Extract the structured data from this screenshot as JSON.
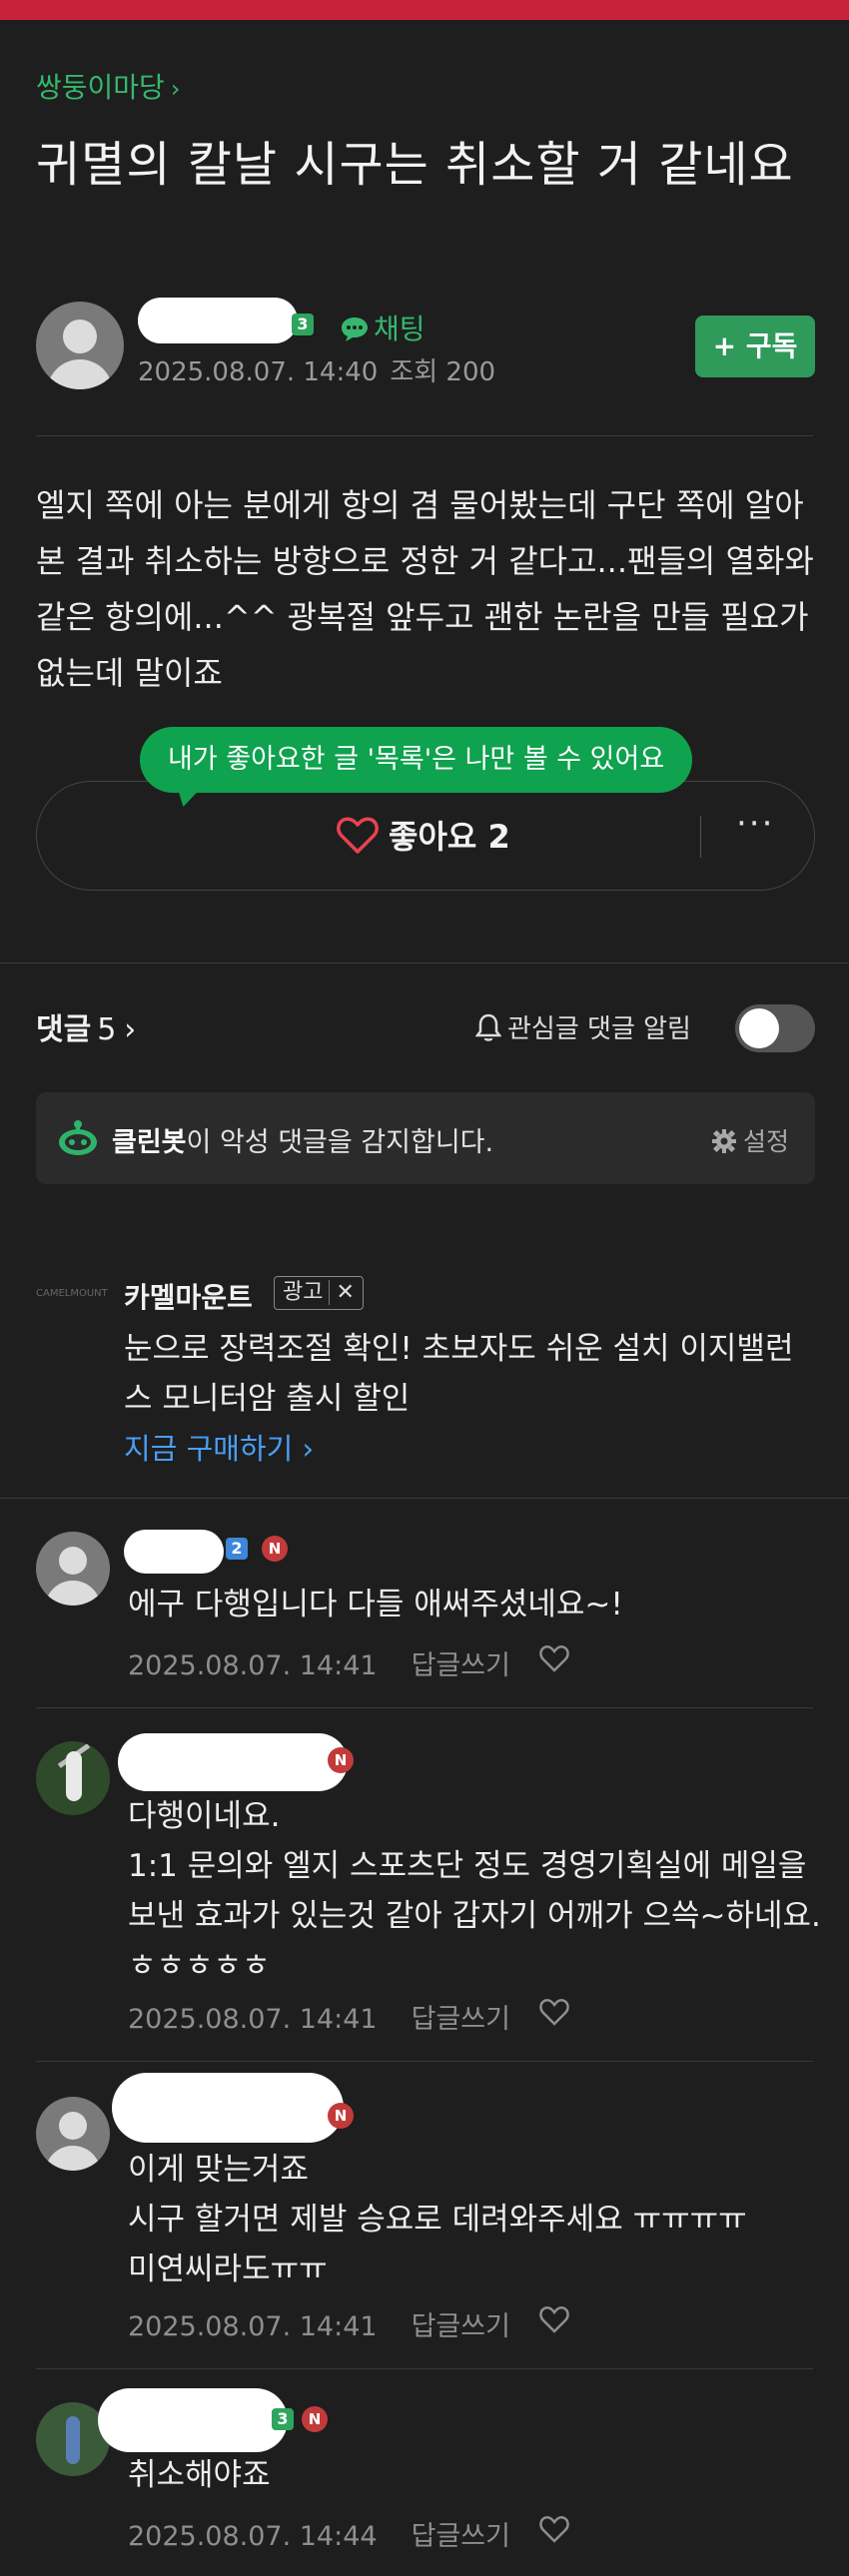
{
  "cafe": {
    "name": "쌍둥이마당",
    "chevron": "›"
  },
  "post": {
    "title": "귀멸의 칼날 시구는 취소할 거 같네요",
    "author_level": "3",
    "chat_label": "채팅",
    "date": "2025.08.07. 14:40",
    "views": "조회 200",
    "subscribe_label": "+ 구독",
    "body": "엘지 쪽에 아는 분에게 항의 겸 물어봤는데 구단 쪽에 알아본 결과 취소하는 방향으로 정한 거 같다고...팬들의 열화와 같은 항의에...^^ 광복절 앞두고 괜한 논란을 만들 필요가 없는데 말이죠"
  },
  "tooltip": "내가 좋아요한 글 '목록'은 나만 볼 수 있어요",
  "like": {
    "label": "좋아요 2",
    "more": "···",
    "heart_icon": "heart-outline-icon",
    "heart_color": "#e8434f"
  },
  "comments_section": {
    "title": "댓글",
    "count": "5",
    "chevron": "›",
    "alarm_label": "관심글 댓글 알림",
    "alarm_enabled": false
  },
  "cleanbot": {
    "name": "클린봇",
    "message": "이 악성 댓글을 감지합니다.",
    "setting_label": "설정"
  },
  "ad": {
    "logo_text": "CAMELMOUNT",
    "advertiser": "카멜마운트",
    "tag": "광고",
    "close": "✕",
    "body": "눈으로 장력조절 확인! 초보자도 쉬운 설치 이지밸런스 모니터암 출시 할인",
    "link": "지금 구매하기 ›"
  },
  "comments": [
    {
      "level": "2",
      "badge": "N",
      "text": "에구 다행입니다 다들 애써주셨네요~!",
      "date": "2025.08.07. 14:41",
      "reply": "답글쓰기"
    },
    {
      "badge": "N",
      "text_lines": [
        "다행이네요.",
        "1:1 문의와 엘지 스포츠단 정도 경영기획실에 메일을 보낸 효과가 있는것 같아 갑자기 어깨가 으쓱~하네요. ㅎㅎㅎㅎㅎ"
      ],
      "date": "2025.08.07. 14:41",
      "reply": "답글쓰기"
    },
    {
      "badge": "N",
      "text_lines": [
        "이게 맞는거죠",
        "시구 할거면 제발 승요로 데려와주세요 ㅠㅠㅠㅠ",
        "미연씨라도ㅠㅠ"
      ],
      "date": "2025.08.07. 14:41",
      "reply": "답글쓰기"
    },
    {
      "level": "3",
      "badge": "N",
      "text": "취소해야죠",
      "date": "2025.08.07. 14:44",
      "reply": "답글쓰기"
    }
  ],
  "colors": {
    "accent_green": "#35b86d",
    "brand_red": "#c8223a",
    "link_blue": "#4a9ff5"
  }
}
